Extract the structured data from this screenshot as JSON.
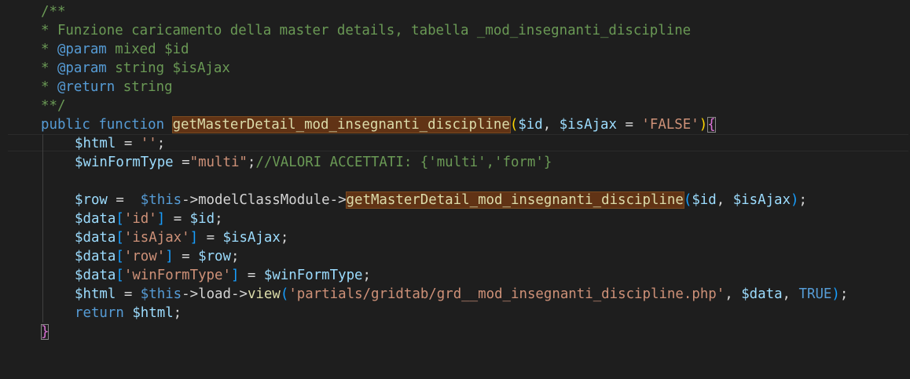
{
  "code": {
    "l1": "/**",
    "l2": "* Funzione caricamento della master details, tabella _mod_insegnanti_discipline",
    "l3_star": "* ",
    "l3_tag": "@param",
    "l3_rest": " mixed ",
    "l3_var": "$id",
    "l4_star": "* ",
    "l4_tag": "@param",
    "l4_rest": " string ",
    "l4_var": "$isAjax",
    "l5_star": "* ",
    "l5_tag": "@return",
    "l5_rest": " string",
    "l6": "**/",
    "l7_public": "public",
    "l7_function": "function",
    "l7_fname": "getMasterDetail_mod_insegnanti_discipline",
    "l7_paren_open": "(",
    "l7_id": "$id",
    "l7_comma": ", ",
    "l7_isajax": "$isAjax",
    "l7_eq": " = ",
    "l7_false": "'FALSE'",
    "l7_paren_close": ")",
    "l7_brace": "{",
    "l8_var": "$html",
    "l8_eq": " = ",
    "l8_str": "''",
    "l8_semi": ";",
    "l9_var": "$winFormType",
    "l9_eq": " =",
    "l9_str": "\"multi\"",
    "l9_semi": ";",
    "l9_comment": "//VALORI ACCETTATI: {'multi','form'}",
    "l11_var": "$row",
    "l11_eq": " =  ",
    "l11_this": "$this",
    "l11_arrow": "->modelClassModule->",
    "l11_fname": "getMasterDetail_mod_insegnanti_discipline",
    "l11_paren_open": "(",
    "l11_id": "$id",
    "l11_comma": ", ",
    "l11_isajax": "$isAjax",
    "l11_paren_close": ")",
    "l11_semi": ";",
    "l12_var": "$data",
    "l12_bo": "[",
    "l12_key": "'id'",
    "l12_bc": "]",
    "l12_eq": " = ",
    "l12_val": "$id",
    "l12_semi": ";",
    "l13_var": "$data",
    "l13_bo": "[",
    "l13_key": "'isAjax'",
    "l13_bc": "]",
    "l13_eq": " = ",
    "l13_val": "$isAjax",
    "l13_semi": ";",
    "l14_var": "$data",
    "l14_bo": "[",
    "l14_key": "'row'",
    "l14_bc": "]",
    "l14_eq": " = ",
    "l14_val": "$row",
    "l14_semi": ";",
    "l15_var": "$data",
    "l15_bo": "[",
    "l15_key": "'winFormType'",
    "l15_bc": "]",
    "l15_eq": " = ",
    "l15_val": "$winFormType",
    "l15_semi": ";",
    "l16_var": "$html",
    "l16_eq": " = ",
    "l16_this": "$this",
    "l16_arrow1": "->",
    "l16_load": "load",
    "l16_arrow2": "->",
    "l16_view": "view",
    "l16_po": "(",
    "l16_str": "'partials/gridtab/grd__mod_insegnanti_discipline.php'",
    "l16_comma": ", ",
    "l16_data": "$data",
    "l16_comma2": ", ",
    "l16_true": "TRUE",
    "l16_pc": ")",
    "l16_semi": ";",
    "l17_return": "return",
    "l17_sp": " ",
    "l17_var": "$html",
    "l17_semi": ";",
    "l18_brace": "}"
  },
  "colors": {
    "background": "#1e1e1e",
    "comment": "#6a9955",
    "keyword": "#569cd6",
    "function": "#dcdcaa",
    "variable": "#9cdcfe",
    "string": "#ce9178",
    "highlight": "#613315"
  }
}
